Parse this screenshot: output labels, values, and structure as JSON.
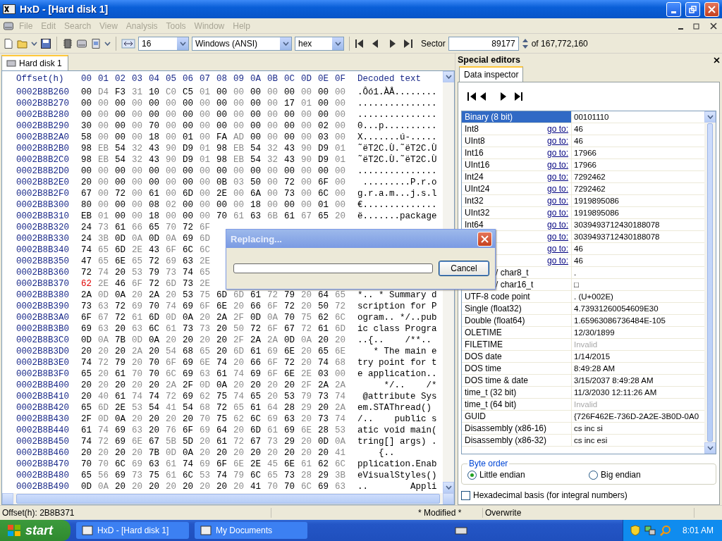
{
  "window": {
    "title": "HxD - [Hard disk 1]"
  },
  "menu": {
    "disabled": true,
    "items": [
      "File",
      "Edit",
      "Search",
      "View",
      "Analysis",
      "Tools",
      "Window",
      "Help"
    ]
  },
  "toolbar": {
    "bytes_per_row": "16",
    "charset": "Windows (ANSI)",
    "offset_base": "hex",
    "sector_label": "Sector",
    "sector": "89177",
    "sector_total": "of 167,772,160"
  },
  "tabs": [
    {
      "label": "Hard disk 1",
      "selected": true
    }
  ],
  "hex_view": {
    "offset_header": "Offset(h)",
    "columns": [
      "00",
      "01",
      "02",
      "03",
      "04",
      "05",
      "06",
      "07",
      "08",
      "09",
      "0A",
      "0B",
      "0C",
      "0D",
      "0E",
      "0F"
    ],
    "decoded_header": "Decoded text",
    "rows": [
      {
        "offset": "0002B8B260",
        "bytes": [
          "00",
          "D4",
          "F3",
          "31",
          "10",
          "C0",
          "C5",
          "01",
          "00",
          "00",
          "00",
          "00",
          "00",
          "00",
          "00",
          "00"
        ],
        "decoded": ".Ôó1.ÀÅ........"
      },
      {
        "offset": "0002B8B270",
        "bytes": [
          "00",
          "00",
          "00",
          "00",
          "00",
          "00",
          "00",
          "00",
          "00",
          "00",
          "00",
          "00",
          "17",
          "01",
          "00",
          "00"
        ],
        "decoded": "..............."
      },
      {
        "offset": "0002B8B280",
        "bytes": [
          "00",
          "00",
          "00",
          "00",
          "00",
          "00",
          "00",
          "00",
          "00",
          "00",
          "00",
          "00",
          "00",
          "00",
          "00",
          "00"
        ],
        "decoded": "..............."
      },
      {
        "offset": "0002B8B290",
        "bytes": [
          "30",
          "00",
          "00",
          "00",
          "70",
          "00",
          "00",
          "00",
          "00",
          "00",
          "00",
          "00",
          "00",
          "00",
          "02",
          "00"
        ],
        "decoded": "0...p.........."
      },
      {
        "offset": "0002B8B2A0",
        "bytes": [
          "58",
          "00",
          "00",
          "00",
          "18",
          "00",
          "01",
          "00",
          "FA",
          "AD",
          "00",
          "00",
          "00",
          "00",
          "03",
          "00"
        ],
        "decoded": "X.......ú-....."
      },
      {
        "offset": "0002B8B2B0",
        "bytes": [
          "98",
          "EB",
          "54",
          "32",
          "43",
          "90",
          "D9",
          "01",
          "98",
          "EB",
          "54",
          "32",
          "43",
          "90",
          "D9",
          "01"
        ],
        "decoded": "˜ëT2C.Ù.˜ëT2C.Ù"
      },
      {
        "offset": "0002B8B2C0",
        "bytes": [
          "98",
          "EB",
          "54",
          "32",
          "43",
          "90",
          "D9",
          "01",
          "98",
          "EB",
          "54",
          "32",
          "43",
          "90",
          "D9",
          "01"
        ],
        "decoded": "˜ëT2C.Ù.˜ëT2C.Ù"
      },
      {
        "offset": "0002B8B2D0",
        "bytes": [
          "00",
          "00",
          "00",
          "00",
          "00",
          "00",
          "00",
          "00",
          "00",
          "00",
          "00",
          "00",
          "00",
          "00",
          "00",
          "00"
        ],
        "decoded": "..............."
      },
      {
        "offset": "0002B8B2E0",
        "bytes": [
          "20",
          "00",
          "00",
          "00",
          "00",
          "00",
          "00",
          "00",
          "0B",
          "03",
          "50",
          "00",
          "72",
          "00",
          "6F",
          "00"
        ],
        "decoded": " .........P.r.o"
      },
      {
        "offset": "0002B8B2F0",
        "bytes": [
          "67",
          "00",
          "72",
          "00",
          "61",
          "00",
          "6D",
          "00",
          "2E",
          "00",
          "6A",
          "00",
          "73",
          "00",
          "6C",
          "00"
        ],
        "decoded": "g.r.a.m...j.s.l"
      },
      {
        "offset": "0002B8B300",
        "bytes": [
          "80",
          "00",
          "00",
          "00",
          "08",
          "02",
          "00",
          "00",
          "00",
          "00",
          "18",
          "00",
          "00",
          "00",
          "01",
          "00"
        ],
        "decoded": "€.............."
      },
      {
        "offset": "0002B8B310",
        "bytes": [
          "EB",
          "01",
          "00",
          "00",
          "18",
          "00",
          "00",
          "00",
          "70",
          "61",
          "63",
          "6B",
          "61",
          "67",
          "65",
          "20"
        ],
        "decoded": "ë.......package"
      },
      {
        "offset": "0002B8B320",
        "bytes": [
          "24",
          "73",
          "61",
          "66",
          "65",
          "70",
          "72",
          "6F"
        ]
      },
      {
        "offset": "0002B8B330",
        "bytes": [
          "24",
          "3B",
          "0D",
          "0A",
          "0D",
          "0A",
          "69",
          "6D"
        ]
      },
      {
        "offset": "0002B8B340",
        "bytes": [
          "74",
          "65",
          "6D",
          "2E",
          "43",
          "6F",
          "6C",
          "6C"
        ]
      },
      {
        "offset": "0002B8B350",
        "bytes": [
          "47",
          "65",
          "6E",
          "65",
          "72",
          "69",
          "63",
          "2E"
        ]
      },
      {
        "offset": "0002B8B360",
        "bytes": [
          "72",
          "74",
          "20",
          "53",
          "79",
          "73",
          "74",
          "65"
        ]
      },
      {
        "offset": "0002B8B370",
        "bytes": [
          {
            "value": "62",
            "modified": true
          },
          "2E",
          "46",
          "6F",
          "72",
          "6D",
          "73",
          "2E"
        ]
      },
      {
        "offset": "0002B8B380",
        "bytes": [
          "2A",
          "0D",
          "0A",
          "20",
          "2A",
          "20",
          "53",
          "75",
          "6D",
          "6D",
          "61",
          "72",
          "79",
          "20",
          "64",
          "65"
        ],
        "decoded": "*.. * Summary d"
      },
      {
        "offset": "0002B8B390",
        "bytes": [
          "73",
          "63",
          "72",
          "69",
          "70",
          "74",
          "69",
          "6F",
          "6E",
          "20",
          "66",
          "6F",
          "72",
          "20",
          "50",
          "72"
        ],
        "decoded": "scription for P"
      },
      {
        "offset": "0002B8B3A0",
        "bytes": [
          "6F",
          "67",
          "72",
          "61",
          "6D",
          "0D",
          "0A",
          "20",
          "2A",
          "2F",
          "0D",
          "0A",
          "70",
          "75",
          "62",
          "6C"
        ],
        "decoded": "ogram.. */..pub"
      },
      {
        "offset": "0002B8B3B0",
        "bytes": [
          "69",
          "63",
          "20",
          "63",
          "6C",
          "61",
          "73",
          "73",
          "20",
          "50",
          "72",
          "6F",
          "67",
          "72",
          "61",
          "6D"
        ],
        "decoded": "ic class Progra"
      },
      {
        "offset": "0002B8B3C0",
        "bytes": [
          "0D",
          "0A",
          "7B",
          "0D",
          "0A",
          "20",
          "20",
          "20",
          "20",
          "2F",
          "2A",
          "2A",
          "0D",
          "0A",
          "20",
          "20"
        ],
        "decoded": "..{..    /**.. "
      },
      {
        "offset": "0002B8B3D0",
        "bytes": [
          "20",
          "20",
          "20",
          "2A",
          "20",
          "54",
          "68",
          "65",
          "20",
          "6D",
          "61",
          "69",
          "6E",
          "20",
          "65",
          "6E"
        ],
        "decoded": "   * The main e"
      },
      {
        "offset": "0002B8B3E0",
        "bytes": [
          "74",
          "72",
          "79",
          "20",
          "70",
          "6F",
          "69",
          "6E",
          "74",
          "20",
          "66",
          "6F",
          "72",
          "20",
          "74",
          "68"
        ],
        "decoded": "try point for t"
      },
      {
        "offset": "0002B8B3F0",
        "bytes": [
          "65",
          "20",
          "61",
          "70",
          "70",
          "6C",
          "69",
          "63",
          "61",
          "74",
          "69",
          "6F",
          "6E",
          "2E",
          "03",
          "00"
        ],
        "decoded": "e application.."
      },
      {
        "offset": "0002B8B400",
        "bytes": [
          "20",
          "20",
          "20",
          "20",
          "20",
          "2A",
          "2F",
          "0D",
          "0A",
          "20",
          "20",
          "20",
          "20",
          "2F",
          "2A",
          "2A"
        ],
        "decoded": "     */..    /*"
      },
      {
        "offset": "0002B8B410",
        "bytes": [
          "20",
          "40",
          "61",
          "74",
          "74",
          "72",
          "69",
          "62",
          "75",
          "74",
          "65",
          "20",
          "53",
          "79",
          "73",
          "74"
        ],
        "decoded": " @attribute Sys"
      },
      {
        "offset": "0002B8B420",
        "bytes": [
          "65",
          "6D",
          "2E",
          "53",
          "54",
          "41",
          "54",
          "68",
          "72",
          "65",
          "61",
          "64",
          "28",
          "29",
          "20",
          "2A"
        ],
        "decoded": "em.STAThread() "
      },
      {
        "offset": "0002B8B430",
        "bytes": [
          "2F",
          "0D",
          "0A",
          "20",
          "20",
          "20",
          "20",
          "70",
          "75",
          "62",
          "6C",
          "69",
          "63",
          "20",
          "73",
          "74"
        ],
        "decoded": "/..    public s"
      },
      {
        "offset": "0002B8B440",
        "bytes": [
          "61",
          "74",
          "69",
          "63",
          "20",
          "76",
          "6F",
          "69",
          "64",
          "20",
          "6D",
          "61",
          "69",
          "6E",
          "28",
          "53"
        ],
        "decoded": "atic void main("
      },
      {
        "offset": "0002B8B450",
        "bytes": [
          "74",
          "72",
          "69",
          "6E",
          "67",
          "5B",
          "5D",
          "20",
          "61",
          "72",
          "67",
          "73",
          "29",
          "20",
          "0D",
          "0A"
        ],
        "decoded": "tring[] args) ."
      },
      {
        "offset": "0002B8B460",
        "bytes": [
          "20",
          "20",
          "20",
          "20",
          "7B",
          "0D",
          "0A",
          "20",
          "20",
          "20",
          "20",
          "20",
          "20",
          "20",
          "20",
          "41"
        ],
        "decoded": "    {..        "
      },
      {
        "offset": "0002B8B470",
        "bytes": [
          "70",
          "70",
          "6C",
          "69",
          "63",
          "61",
          "74",
          "69",
          "6F",
          "6E",
          "2E",
          "45",
          "6E",
          "61",
          "62",
          "6C"
        ],
        "decoded": "pplication.Enab"
      },
      {
        "offset": "0002B8B480",
        "bytes": [
          "65",
          "56",
          "69",
          "73",
          "75",
          "61",
          "6C",
          "53",
          "74",
          "79",
          "6C",
          "65",
          "73",
          "28",
          "29",
          "3B"
        ],
        "decoded": "eVisualStyles()"
      },
      {
        "offset": "0002B8B490",
        "bytes": [
          "0D",
          "0A",
          "20",
          "20",
          "20",
          "20",
          "20",
          "20",
          "20",
          "20",
          "41",
          "70",
          "70",
          "6C",
          "69",
          "63"
        ],
        "decoded": "..        Appli"
      }
    ]
  },
  "dialog": {
    "title": "Replacing...",
    "progress": {
      "level": 0
    },
    "cancel": "Cancel"
  },
  "special_editors": {
    "title": "Special editors",
    "tabs": [
      {
        "label": "Data inspector",
        "selected": true
      }
    ],
    "rows": [
      {
        "label": "Binary (8 bit)",
        "value": "00101110",
        "selected": true,
        "invalid": false
      },
      {
        "label": "Int8",
        "goto": "go to:",
        "value": "46",
        "selected": false,
        "invalid": false
      },
      {
        "label": "UInt8",
        "goto": "go to:",
        "value": "46",
        "selected": false,
        "invalid": false
      },
      {
        "label": "Int16",
        "goto": "go to:",
        "value": "17966",
        "selected": false,
        "invalid": false
      },
      {
        "label": "UInt16",
        "goto": "go to:",
        "value": "17966",
        "selected": false,
        "invalid": false
      },
      {
        "label": "Int24",
        "goto": "go to:",
        "value": "7292462",
        "selected": false,
        "invalid": false
      },
      {
        "label": "UInt24",
        "goto": "go to:",
        "value": "7292462",
        "selected": false,
        "invalid": false
      },
      {
        "label": "Int32",
        "goto": "go to:",
        "value": "1919895086",
        "selected": false,
        "invalid": false
      },
      {
        "label": "UInt32",
        "goto": "go to:",
        "value": "1919895086",
        "selected": false,
        "invalid": false
      },
      {
        "label": "Int64",
        "goto": "go to:",
        "value": "3039493712430188078",
        "selected": false,
        "invalid": false
      },
      {
        "goto": "go to:",
        "value": "3039493712430188078",
        "selected": false,
        "invalid": false
      },
      {
        "goto": "go to:",
        "value": "46",
        "selected": false,
        "invalid": false
      },
      {
        "goto": "go to:",
        "value": "46",
        "selected": false,
        "invalid": false
      },
      {
        "label": "/ char8_t",
        "clipped": true,
        "value": ".",
        "selected": false,
        "invalid": false
      },
      {
        "label": "/ char16_t",
        "clipped": true,
        "value": "□",
        "selected": false,
        "invalid": false
      },
      {
        "label": "UTF-8 code point",
        "value": ". (U+002E)",
        "selected": false,
        "invalid": false
      },
      {
        "label": "Single (float32)",
        "value": "4.73931260054609E30",
        "selected": false,
        "invalid": false
      },
      {
        "label": "Double (float64)",
        "value": "1.65963086736484E-105",
        "selected": false,
        "invalid": false
      },
      {
        "label": "OLETIME",
        "value": "12/30/1899",
        "selected": false,
        "invalid": false
      },
      {
        "label": "FILETIME",
        "value": "Invalid",
        "selected": false,
        "invalid": true
      },
      {
        "label": "DOS date",
        "value": "1/14/2015",
        "selected": false,
        "invalid": false
      },
      {
        "label": "DOS time",
        "value": "8:49:28 AM",
        "selected": false,
        "invalid": false
      },
      {
        "label": "DOS time & date",
        "value": "3/15/2037 8:49:28 AM",
        "selected": false,
        "invalid": false
      },
      {
        "label": "time_t (32 bit)",
        "value": "11/3/2030 12:11:26 AM",
        "selected": false,
        "invalid": false
      },
      {
        "label": "time_t (64 bit)",
        "value": "Invalid",
        "selected": false,
        "invalid": true
      },
      {
        "label": "GUID",
        "value": "{726F462E-736D-2A2E-3B0D-0A0",
        "selected": false,
        "invalid": false
      },
      {
        "label": "Disassembly (x86-16)",
        "value": "cs inc si",
        "selected": false,
        "invalid": false
      },
      {
        "label": "Disassembly (x86-32)",
        "value": "cs inc esi",
        "selected": false,
        "invalid": false
      }
    ],
    "byte_order": {
      "title": "Byte order",
      "options": [
        {
          "label": "Little endian",
          "selected": true
        },
        {
          "label": "Big endian",
          "selected": false
        }
      ]
    },
    "hex_basis": {
      "label": "Hexadecimal basis (for integral numbers)",
      "checked": false
    }
  },
  "status_bar": [
    "Offset(h): 2B8B371",
    "* Modified *",
    "Overwrite"
  ],
  "taskbar": {
    "start": "start",
    "tasks": [
      "HxD - [Hard disk 1]",
      "My Documents"
    ],
    "clock": "8:01 AM"
  }
}
